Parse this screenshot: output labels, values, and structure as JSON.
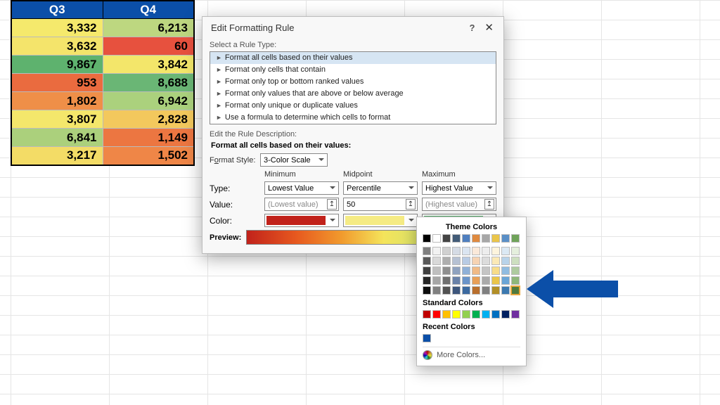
{
  "table": {
    "headers": [
      "Q3",
      "Q4"
    ],
    "rows": [
      {
        "cells": [
          {
            "v": "3,332",
            "bg": "#f5e96c"
          },
          {
            "v": "6,213",
            "bg": "#bdd780"
          }
        ]
      },
      {
        "cells": [
          {
            "v": "3,632",
            "bg": "#f4e46b"
          },
          {
            "v": "60",
            "bg": "#e7513e"
          }
        ]
      },
      {
        "cells": [
          {
            "v": "9,867",
            "bg": "#5eb26e"
          },
          {
            "v": "3,842",
            "bg": "#f3e66a"
          }
        ]
      },
      {
        "cells": [
          {
            "v": "953",
            "bg": "#ea6b3f"
          },
          {
            "v": "8,688",
            "bg": "#6ab675"
          }
        ]
      },
      {
        "cells": [
          {
            "v": "1,802",
            "bg": "#ef8f48"
          },
          {
            "v": "6,942",
            "bg": "#abd17d"
          }
        ]
      },
      {
        "cells": [
          {
            "v": "3,807",
            "bg": "#f4e76b"
          },
          {
            "v": "2,828",
            "bg": "#f3c85d"
          }
        ]
      },
      {
        "cells": [
          {
            "v": "6,841",
            "bg": "#abd07c"
          },
          {
            "v": "1,149",
            "bg": "#ec7641"
          }
        ]
      },
      {
        "cells": [
          {
            "v": "3,217",
            "bg": "#f3dc66"
          },
          {
            "v": "1,502",
            "bg": "#ef8647"
          }
        ]
      }
    ]
  },
  "dialog": {
    "title": "Edit Formatting Rule",
    "select_rule_type_label": "Select a Rule Type:",
    "rule_types": [
      "Format all cells based on their values",
      "Format only cells that contain",
      "Format only top or bottom ranked values",
      "Format only values that are above or below average",
      "Format only unique or duplicate values",
      "Use a formula to determine which cells to format"
    ],
    "selected_rule_index": 0,
    "edit_desc_label": "Edit the Rule Description:",
    "desc_heading": "Format all cells based on their values:",
    "format_style_label": "Format Style:",
    "format_style_value": "3-Color Scale",
    "columns": {
      "min": "Minimum",
      "mid": "Midpoint",
      "max": "Maximum"
    },
    "type_label": "Type:",
    "type_values": {
      "min": "Lowest Value",
      "mid": "Percentile",
      "max": "Highest Value"
    },
    "value_label": "Value:",
    "value_values": {
      "min": "(Lowest value)",
      "mid": "50",
      "max": "(Highest value)"
    },
    "color_label": "Color:",
    "colors": {
      "min": "#c1221b",
      "mid": "#f5eb84",
      "max": "#57b26d"
    },
    "preview_label": "Preview:"
  },
  "color_picker": {
    "theme_label": "Theme Colors",
    "theme_row1": [
      "#000000",
      "#ffffff",
      "#444444",
      "#425b77",
      "#4f7fbf",
      "#df8a3f",
      "#a7a7a7",
      "#eac54a",
      "#5a8fc7",
      "#6fa35a"
    ],
    "theme_shades": [
      [
        "#7f7f7f",
        "#f2f2f2",
        "#d0d0d0",
        "#d5dbe5",
        "#dbe5f1",
        "#fbe9d9",
        "#ededed",
        "#fdf4dd",
        "#dbe9f4",
        "#e5efdd"
      ],
      [
        "#595959",
        "#d9d9d9",
        "#aeaeae",
        "#b6c1d3",
        "#b8cbe4",
        "#f6d3b3",
        "#dcdcdc",
        "#fbe9b6",
        "#b8d3ea",
        "#cddfc0"
      ],
      [
        "#404040",
        "#bfbfbf",
        "#8f8f8f",
        "#8fa2bf",
        "#8fb0d7",
        "#f0ba86",
        "#c5c5c5",
        "#f7dc89",
        "#90bce1",
        "#aecb9f"
      ],
      [
        "#262626",
        "#a6a6a6",
        "#6f6f6f",
        "#6a82a9",
        "#6a94c9",
        "#e89f57",
        "#aaaaaa",
        "#eac54a",
        "#6aa5d7",
        "#8eb77a"
      ],
      [
        "#0d0d0d",
        "#808080",
        "#525252",
        "#3d567c",
        "#3c6aa0",
        "#b96f2d",
        "#808080",
        "#b28f27",
        "#3c79b0",
        "#4f7a3c"
      ]
    ],
    "standard_label": "Standard Colors",
    "standard": [
      "#c00000",
      "#ff0000",
      "#ffc000",
      "#ffff00",
      "#92d050",
      "#00b050",
      "#00b0f0",
      "#0070c0",
      "#002060",
      "#7030a0"
    ],
    "recent_label": "Recent Colors",
    "recent": [
      "#0b4fa8"
    ],
    "more_label": "More Colors...",
    "selected_theme": {
      "row": 5,
      "col": 9
    }
  }
}
